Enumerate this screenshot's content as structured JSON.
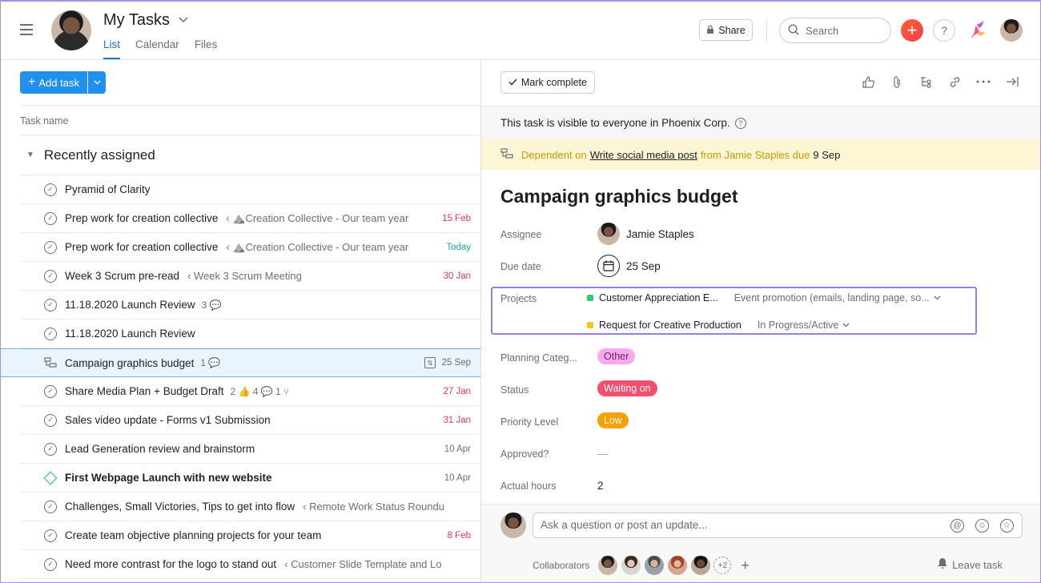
{
  "header": {
    "title": "My Tasks",
    "tabs": [
      {
        "label": "List",
        "active": true
      },
      {
        "label": "Calendar",
        "active": false
      },
      {
        "label": "Files",
        "active": false
      }
    ],
    "share_label": "Share",
    "search_placeholder": "Search",
    "plus_icon": "+",
    "help_icon": "?"
  },
  "left": {
    "add_task_label": "Add task",
    "column_header": "Task name",
    "section_title": "Recently assigned",
    "tasks": [
      {
        "name": "Pyramid of Clarity",
        "project": "",
        "meta": "",
        "date": "",
        "date_color": "",
        "bold": false,
        "type": "check"
      },
      {
        "name": "Prep work for creation collective",
        "project": "⛰️Creation Collective - Our team year",
        "meta": "",
        "date": "15 Feb",
        "date_color": "red",
        "bold": false,
        "type": "check"
      },
      {
        "name": "Prep work for creation collective",
        "project": "⛰️Creation Collective - Our team year",
        "meta": "",
        "date": "Today",
        "date_color": "green",
        "bold": false,
        "type": "check"
      },
      {
        "name": "Week 3 Scrum pre-read",
        "project": "Week 3 Scrum Meeting",
        "meta": "",
        "date": "30 Jan",
        "date_color": "red",
        "bold": false,
        "type": "check"
      },
      {
        "name": "11.18.2020 Launch Review",
        "project": "",
        "meta": "3 💬",
        "date": "",
        "date_color": "",
        "bold": false,
        "type": "check"
      },
      {
        "name": "11.18.2020 Launch Review",
        "project": "",
        "meta": "",
        "date": "",
        "date_color": "",
        "bold": false,
        "type": "check"
      },
      {
        "name": "Campaign graphics budget",
        "project": "",
        "meta": "1 💬",
        "date": "25 Sep",
        "date_color": "",
        "bold": false,
        "type": "dependency",
        "selected": true
      },
      {
        "name": "Share Media Plan + Budget Draft",
        "project": "",
        "meta": "2 👍  4 💬  1 ⑂",
        "date": "27 Jan",
        "date_color": "red",
        "bold": false,
        "type": "check"
      },
      {
        "name": "Sales video update - Forms v1 Submission",
        "project": "",
        "meta": "",
        "date": "31 Jan",
        "date_color": "red",
        "bold": false,
        "type": "check"
      },
      {
        "name": "Lead Generation review and brainstorm",
        "project": "",
        "meta": "",
        "date": "10 Apr",
        "date_color": "",
        "bold": false,
        "type": "check"
      },
      {
        "name": "First Webpage Launch with new website",
        "project": "",
        "meta": "",
        "date": "10 Apr",
        "date_color": "",
        "bold": true,
        "type": "milestone"
      },
      {
        "name": "Challenges, Small Victories, Tips to get into flow",
        "project": "Remote Work Status Roundu",
        "meta": "",
        "date": "",
        "date_color": "",
        "bold": false,
        "type": "check"
      },
      {
        "name": "Create team objective planning projects for your team",
        "project": "",
        "meta": "",
        "date": "8 Feb",
        "date_color": "red",
        "bold": false,
        "type": "check"
      },
      {
        "name": "Need more contrast for the logo to stand out",
        "project": "Customer Slide Template and Lo",
        "meta": "",
        "date": "",
        "date_color": "",
        "bold": false,
        "type": "check"
      }
    ]
  },
  "detail": {
    "mark_complete_label": "Mark complete",
    "visibility_text": "This task is visible to everyone in Phoenix Corp.",
    "dependency": {
      "prefix": "Dependent on",
      "task_link": "Write social media post",
      "from_text": "from Jamie Staples due",
      "due": "9 Sep"
    },
    "title": "Campaign graphics budget",
    "assignee_label": "Assignee",
    "assignee_name": "Jamie Staples",
    "due_label": "Due date",
    "due_value": "25 Sep",
    "projects_label": "Projects",
    "projects": [
      {
        "name": "Customer Appreciation E...",
        "section": "Event promotion (emails, landing page, so...",
        "color": "#2ecc71"
      },
      {
        "name": "Request for Creative Production",
        "section": "In Progress/Active",
        "color": "#f5c518"
      }
    ],
    "fields": [
      {
        "label": "Planning Categ...",
        "value": "Other",
        "bg": "#f9aaef",
        "fg": "#7a2060"
      },
      {
        "label": "Status",
        "value": "Waiting on",
        "bg": "#f0506e",
        "fg": "#ffffff"
      },
      {
        "label": "Priority Level",
        "value": "Low",
        "bg": "#f8a100",
        "fg": "#ffffff"
      },
      {
        "label": "Approved?",
        "value": "—",
        "bg": "",
        "fg": "#9ca6af"
      },
      {
        "label": "Actual hours",
        "value": "2",
        "bg": "",
        "fg": "#1e1f21"
      }
    ],
    "comment_placeholder": "Ask a question or post an update...",
    "collaborators_label": "Collaborators",
    "collaborators_more": "+2",
    "leave_label": "Leave task"
  },
  "colors": {
    "accent": "#1f8ff0",
    "selection_bg": "#e9f4fc",
    "projects_box_border": "#9d7ce0",
    "dependency_bg": "#fdf6d4"
  }
}
